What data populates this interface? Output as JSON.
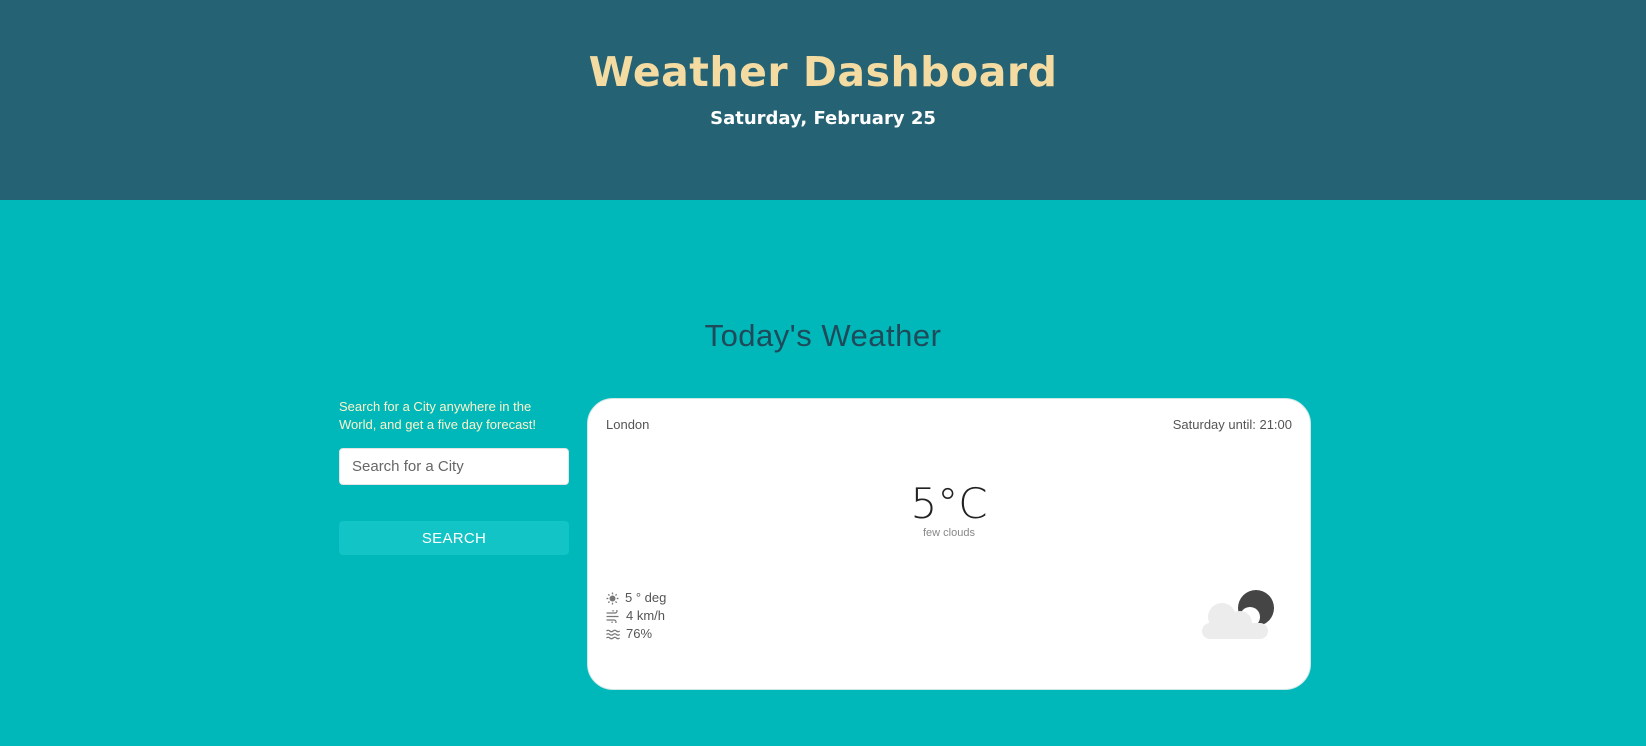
{
  "header": {
    "title": "Weather Dashboard",
    "date": "Saturday, February 25"
  },
  "main": {
    "section_title": "Today's Weather"
  },
  "search": {
    "hint": "Search for a City anywhere in the World, and get a five day forecast!",
    "placeholder": "Search for a City",
    "button_label": "SEARCH"
  },
  "card": {
    "city": "London",
    "until": "Saturday until: 21:00",
    "temperature": "5°C",
    "description": "few clouds",
    "stats": {
      "temp": "5 ° deg",
      "wind": "4 km/h",
      "humidity": "76%"
    },
    "icon": "few-clouds-night-icon"
  },
  "colors": {
    "header_bg": "#256273",
    "title_color": "#f3dba1",
    "page_bg": "#00b8b9",
    "button_bg": "#12c4c5"
  }
}
